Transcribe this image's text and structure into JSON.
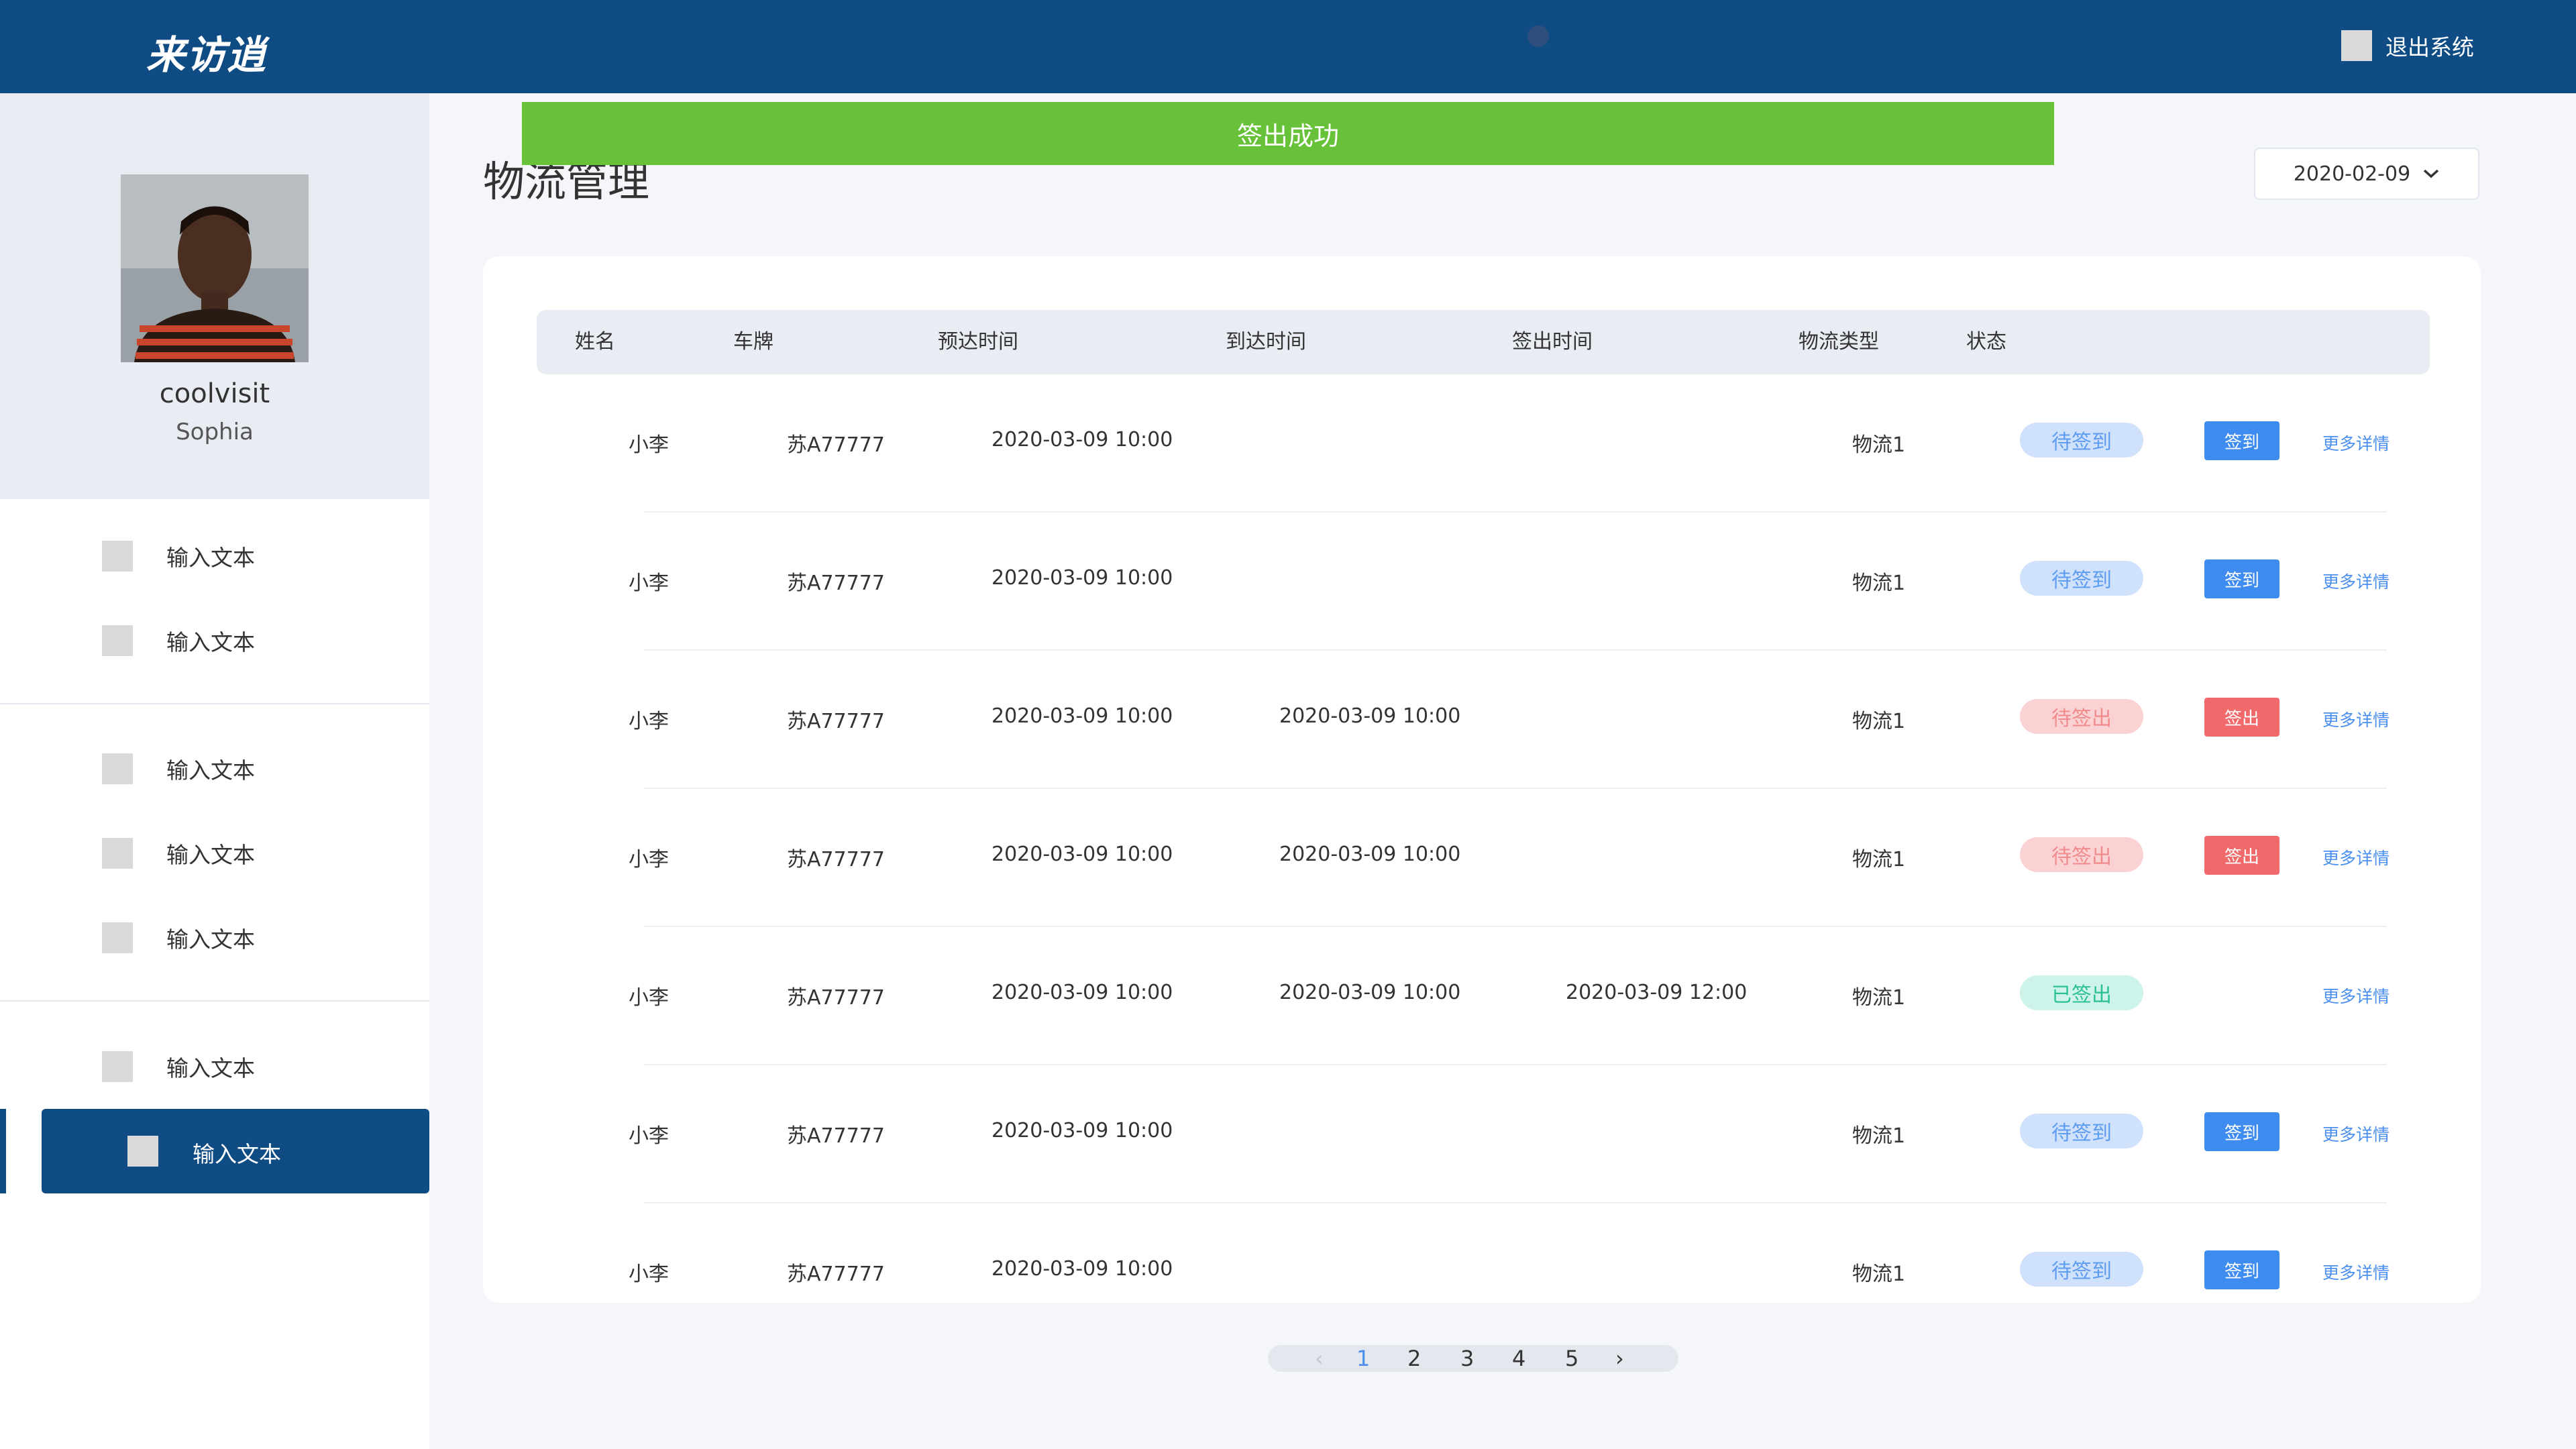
{
  "header": {
    "logo_text": "来访逍",
    "logout_label": "退出系统"
  },
  "profile": {
    "name": "coolvisit",
    "subname": "Sophia"
  },
  "sidebar": {
    "items": [
      {
        "label": "输入文本"
      },
      {
        "label": "输入文本"
      },
      {
        "label": "输入文本"
      },
      {
        "label": "输入文本"
      },
      {
        "label": "输入文本"
      },
      {
        "label": "输入文本"
      },
      {
        "label": "输入文本"
      }
    ]
  },
  "toast": {
    "text": "签出成功"
  },
  "page": {
    "title": "物流管理",
    "date": "2020-02-09"
  },
  "table": {
    "headers": [
      "姓名",
      "车牌",
      "预达时间",
      "到达时间",
      "签出时间",
      "物流类型",
      "状态"
    ],
    "more_label": "更多详情",
    "rows": [
      {
        "name": "小李",
        "plate": "苏A77777",
        "expected": "2020-03-09 10:00",
        "arrived": "",
        "signout": "",
        "type": "物流1",
        "status": "待签到",
        "action": "签到"
      },
      {
        "name": "小李",
        "plate": "苏A77777",
        "expected": "2020-03-09 10:00",
        "arrived": "",
        "signout": "",
        "type": "物流1",
        "status": "待签到",
        "action": "签到"
      },
      {
        "name": "小李",
        "plate": "苏A77777",
        "expected": "2020-03-09 10:00",
        "arrived": "2020-03-09 10:00",
        "signout": "",
        "type": "物流1",
        "status": "待签出",
        "action": "签出"
      },
      {
        "name": "小李",
        "plate": "苏A77777",
        "expected": "2020-03-09 10:00",
        "arrived": "2020-03-09 10:00",
        "signout": "",
        "type": "物流1",
        "status": "待签出",
        "action": "签出"
      },
      {
        "name": "小李",
        "plate": "苏A77777",
        "expected": "2020-03-09 10:00",
        "arrived": "2020-03-09 10:00",
        "signout": "2020-03-09 12:00",
        "type": "物流1",
        "status": "已签出",
        "action": ""
      },
      {
        "name": "小李",
        "plate": "苏A77777",
        "expected": "2020-03-09 10:00",
        "arrived": "",
        "signout": "",
        "type": "物流1",
        "status": "待签到",
        "action": "签到"
      },
      {
        "name": "小李",
        "plate": "苏A77777",
        "expected": "2020-03-09 10:00",
        "arrived": "",
        "signout": "",
        "type": "物流1",
        "status": "待签到",
        "action": "签到"
      }
    ]
  },
  "pagination": {
    "pages": [
      "1",
      "2",
      "3",
      "4",
      "5"
    ],
    "current": "1",
    "prev_icon": "‹",
    "next_icon": "›"
  },
  "icons": {
    "logout": "logout-icon",
    "chevron": "chevron-down-icon",
    "menu": "menu-item-icon"
  },
  "colors": {
    "header_bg": "#104c84",
    "toast_bg": "#67c23a",
    "status_wait_in": "#5d9cf0",
    "status_wait_out": "#f08b8d",
    "status_done": "#2bbf98"
  }
}
